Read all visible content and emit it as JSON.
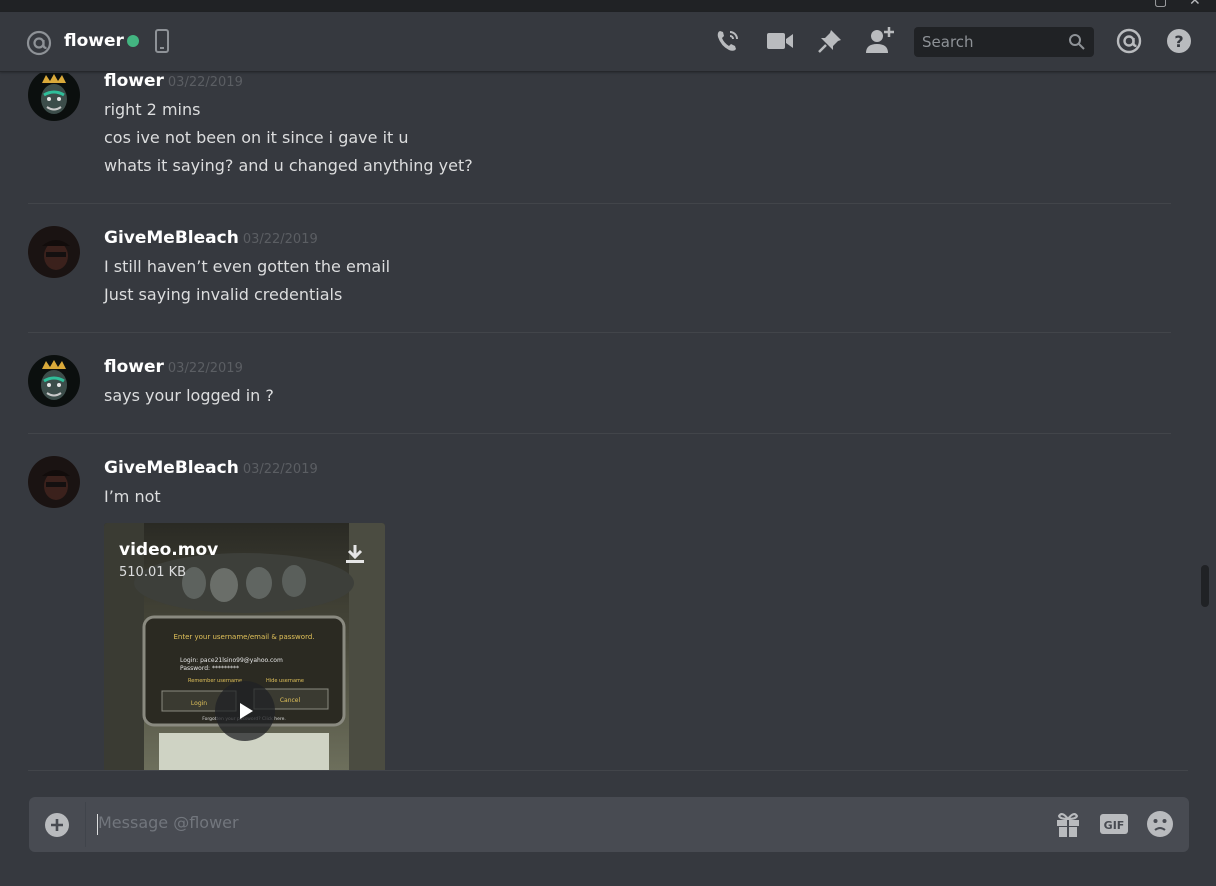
{
  "header": {
    "channel_name": "flower",
    "status_color": "#43b581",
    "search_placeholder": "Search"
  },
  "messages": [
    {
      "author": "flower",
      "timestamp": "03/22/2019",
      "lines": [
        "right 2 mins",
        "cos ive not been on it since i gave it u",
        "whats it saying? and u changed anything yet?"
      ]
    },
    {
      "author": "GiveMeBleach",
      "timestamp": "03/22/2019",
      "lines": [
        "I still haven’t even gotten the email",
        "Just saying invalid credentials"
      ]
    },
    {
      "author": "flower",
      "timestamp": "03/22/2019",
      "lines": [
        "says your logged in ?"
      ]
    },
    {
      "author": "GiveMeBleach",
      "timestamp": "03/22/2019",
      "lines": [
        "I’m not"
      ],
      "attachment": {
        "filename": "video.mov",
        "size": "510.01 KB",
        "video_frame_text": {
          "prompt": "Enter your username/email & password.",
          "login_line": "Login: pace21lsino99@yahoo.com",
          "password_line": "Password: *********",
          "remember": "Remember username",
          "hide": "Hide username",
          "login_btn": "Login",
          "cancel_btn": "Cancel",
          "forgotten": "Forgotten your password? Click here."
        }
      }
    }
  ],
  "composer": {
    "placeholder": "Message @flower"
  },
  "icons": {
    "header": [
      "at-icon",
      "mobile-icon",
      "call-icon",
      "video-call-icon",
      "pin-icon",
      "add-friend-icon",
      "search-icon",
      "mentions-icon",
      "help-icon"
    ],
    "composer": [
      "upload-icon",
      "gift-icon",
      "gif-icon",
      "emoji-icon"
    ]
  },
  "colors": {
    "background": "#36393f",
    "online": "#43b581",
    "composer": "#484b52"
  }
}
